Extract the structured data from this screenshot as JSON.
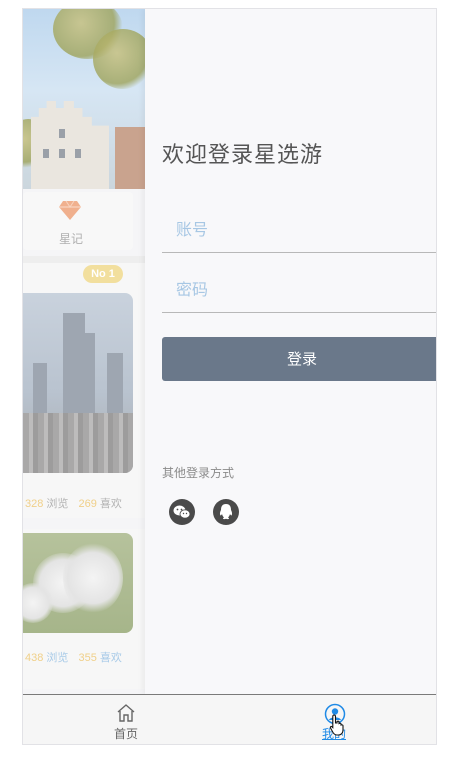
{
  "background_page": {
    "tile_label": "星记",
    "badge": "No 1",
    "card1_stats": {
      "views": "328",
      "views_label": "浏览",
      "likes": "269",
      "likes_label": "喜欢"
    },
    "card2_stats": {
      "views": "438",
      "views_label": "浏览",
      "likes": "355",
      "likes_label": "喜欢"
    }
  },
  "login": {
    "title": "欢迎登录星选游",
    "account_placeholder": "账号",
    "account_value": "",
    "password_placeholder": "密码",
    "password_value": "",
    "submit_label": "登录",
    "other_methods_label": "其他登录方式",
    "methods": [
      "wechat-icon",
      "qq-icon"
    ],
    "button_color": "#6a788a",
    "placeholder_color": "#a7c7e4"
  },
  "tabbar": {
    "items": [
      {
        "label": "首页",
        "icon": "home-icon",
        "active": false
      },
      {
        "label": "我的",
        "icon": "user-icon",
        "active": true
      }
    ],
    "active_color": "#1f8ae6"
  }
}
